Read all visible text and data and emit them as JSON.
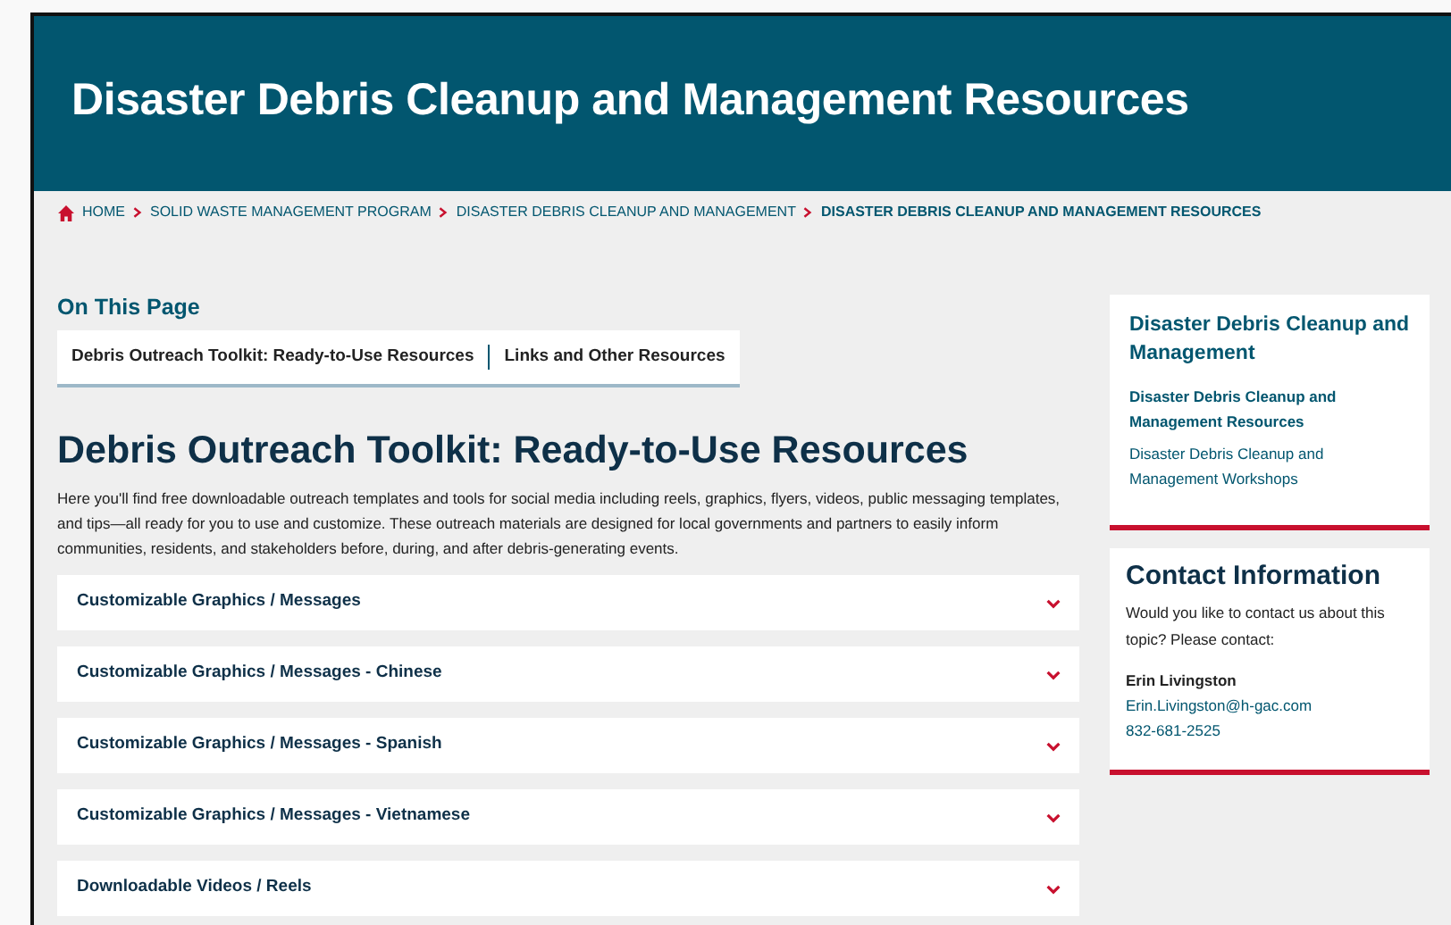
{
  "page_title": "Disaster Debris Cleanup and Management Resources",
  "breadcrumbs": [
    {
      "label": "HOME",
      "current": false
    },
    {
      "label": "SOLID WASTE MANAGEMENT PROGRAM",
      "current": false
    },
    {
      "label": "DISASTER DEBRIS CLEANUP AND MANAGEMENT",
      "current": false
    },
    {
      "label": "DISASTER DEBRIS CLEANUP AND MANAGEMENT RESOURCES",
      "current": true
    }
  ],
  "on_this_page": {
    "heading": "On This Page",
    "links": [
      "Debris Outreach Toolkit: Ready-to-Use Resources",
      "Links and Other Resources"
    ]
  },
  "section": {
    "heading": "Debris Outreach Toolkit: Ready-to-Use Resources",
    "intro": "Here you'll find free downloadable outreach templates and tools for social media including reels, graphics, flyers, videos, public messaging templates, and tips—all ready for you to use and customize. These outreach materials are designed for local governments and partners to easily inform communities, residents, and stakeholders before, during, and after debris-generating events."
  },
  "accordion": [
    {
      "label": "Customizable Graphics / Messages",
      "expanded": false
    },
    {
      "label": "Customizable Graphics / Messages - Chinese",
      "expanded": false
    },
    {
      "label": "Customizable Graphics / Messages - Spanish",
      "expanded": false
    },
    {
      "label": "Customizable Graphics / Messages - Vietnamese",
      "expanded": false
    },
    {
      "label": "Downloadable Videos / Reels",
      "expanded": false
    }
  ],
  "sidebar": {
    "heading": "Disaster Debris Cleanup and Management",
    "items": [
      {
        "label": "Disaster Debris Cleanup and Management Resources",
        "selected": true
      },
      {
        "label": "Disaster Debris Cleanup and Management Workshops",
        "selected": false
      }
    ]
  },
  "contact": {
    "heading": "Contact Information",
    "prompt": "Would you like to contact us about this topic? Please contact:",
    "name": "Erin Livingston",
    "email": "Erin.Livingston@h-gac.com",
    "phone": "832-681-2525"
  }
}
